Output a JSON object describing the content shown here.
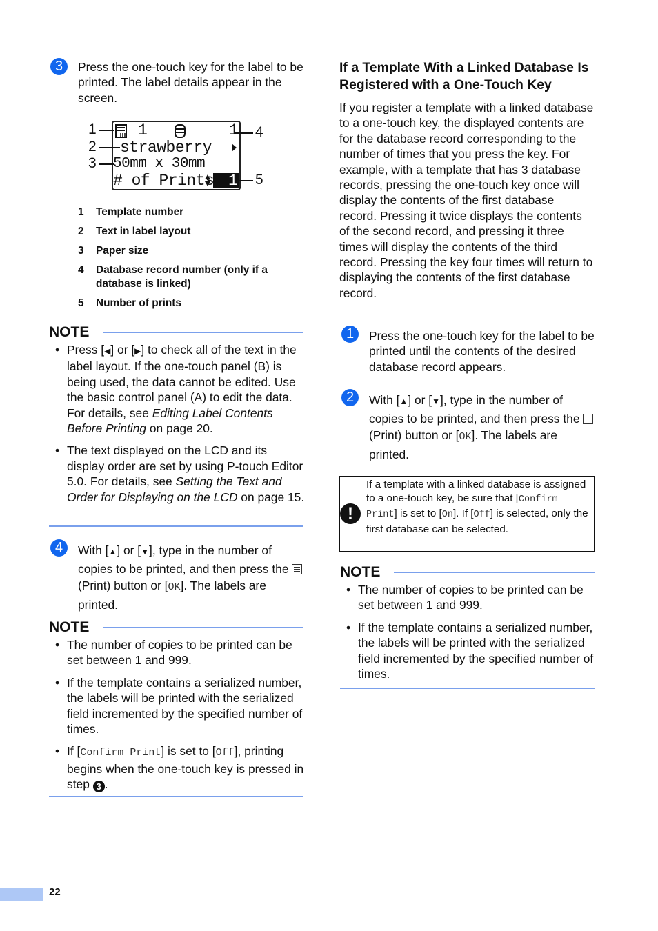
{
  "left_column": {
    "step3": {
      "number": "3",
      "text": "Press the one-touch key for the label to be printed. The label details appear in the screen."
    },
    "lcd": {
      "line1_template_number": "1",
      "line1_record_number": "1",
      "line2_text": "strawberry",
      "line3_paper_size": "50mm x 30mm",
      "line4_label": "# of Prints",
      "line4_value": "1",
      "icons": [
        "template-icon",
        "database-icon",
        "right-arrow-icon",
        "up-down-icon"
      ],
      "callouts": [
        "1",
        "2",
        "3",
        "4",
        "5"
      ]
    },
    "legend": [
      {
        "num": "1",
        "label": "Template number"
      },
      {
        "num": "2",
        "label": "Text in label layout"
      },
      {
        "num": "3",
        "label": "Paper size"
      },
      {
        "num": "4",
        "label": "Database record number (only if a database is linked)"
      },
      {
        "num": "5",
        "label": "Number of prints"
      }
    ],
    "note1": {
      "heading": "NOTE",
      "bullet1": {
        "a": "Press [",
        "left_key": "◀",
        "b": "] or [",
        "right_key": "▶",
        "c": "] to check all of the text in the label layout. If the one-touch panel (B) is being used, the data cannot be edited. Use the basic control panel (A) to edit the data. For details, see ",
        "link": "Editing Label Contents Before Printing",
        "d": " on page 20."
      },
      "bullet2": {
        "a": "The text displayed on the LCD and its display order are set by using P-touch Editor 5.0. For details, see ",
        "link": "Setting the Text and Order for Displaying on the LCD",
        "d": " on page 15."
      }
    },
    "step4": {
      "number": "4",
      "a": "With [",
      "up_key": "▲",
      "b": "] or [",
      "down_key": "▼",
      "c": "], type in the number of copies to be printed, and then press the ",
      "d": " (Print) button or [",
      "ok": "OK",
      "e": "]. The labels are printed."
    },
    "note2": {
      "heading": "NOTE",
      "bullet1": "The number of copies to be printed can be set between 1 and 999.",
      "bullet2": "If the template contains a serialized number, the labels will be printed with the serialized field incremented by the specified number of times.",
      "bullet3": {
        "a": "If [",
        "confirm": "Confirm Print",
        "b": "] is set to [",
        "off": "Off",
        "c": "], printing begins when the one-touch key is pressed in step ",
        "step_ref": "3",
        "d": "."
      }
    }
  },
  "right_column": {
    "heading": "If a Template With a Linked Database Is Registered with a One-Touch Key",
    "intro": "If you register a template with a linked database to a one-touch key, the displayed contents are for the database record corresponding to the number of times that you press the key. For example, with a template that has 3 database records, pressing the one-touch key once will display the contents of the first database record. Pressing it twice displays the contents of the second record, and pressing it three times will display the contents of the third record. Pressing the key four times will return to displaying the contents of the first database record.",
    "step1": {
      "number": "1",
      "text": "Press the one-touch key for the label to be printed until the contents of the desired database record appears."
    },
    "step2": {
      "number": "2",
      "a": "With [",
      "up_key": "▲",
      "b": "] or [",
      "down_key": "▼",
      "c": "], type in the number of copies to be printed, and then press the ",
      "d": " (Print) button or [",
      "ok": "OK",
      "e": "]. The labels are printed."
    },
    "caution": {
      "icon": "!",
      "a": "If a template with a linked database is assigned to a one-touch key, be sure that [",
      "confirm": "Confirm Print",
      "b": "] is set to [",
      "on": "On",
      "c": "]. If [",
      "off": "Off",
      "d": "] is selected, only the first database can be selected."
    },
    "note": {
      "heading": "NOTE",
      "bullet1": "The number of copies to be printed can be set between 1 and 999.",
      "bullet2": "If the template contains a serialized number, the labels will be printed with the serialized field incremented by the specified number of times."
    }
  },
  "footer": {
    "page_number": "22",
    "accent_color": "#aec8f6"
  },
  "colors": {
    "step_badge": "#1166ee",
    "note_rule": "#7aa0ec"
  }
}
